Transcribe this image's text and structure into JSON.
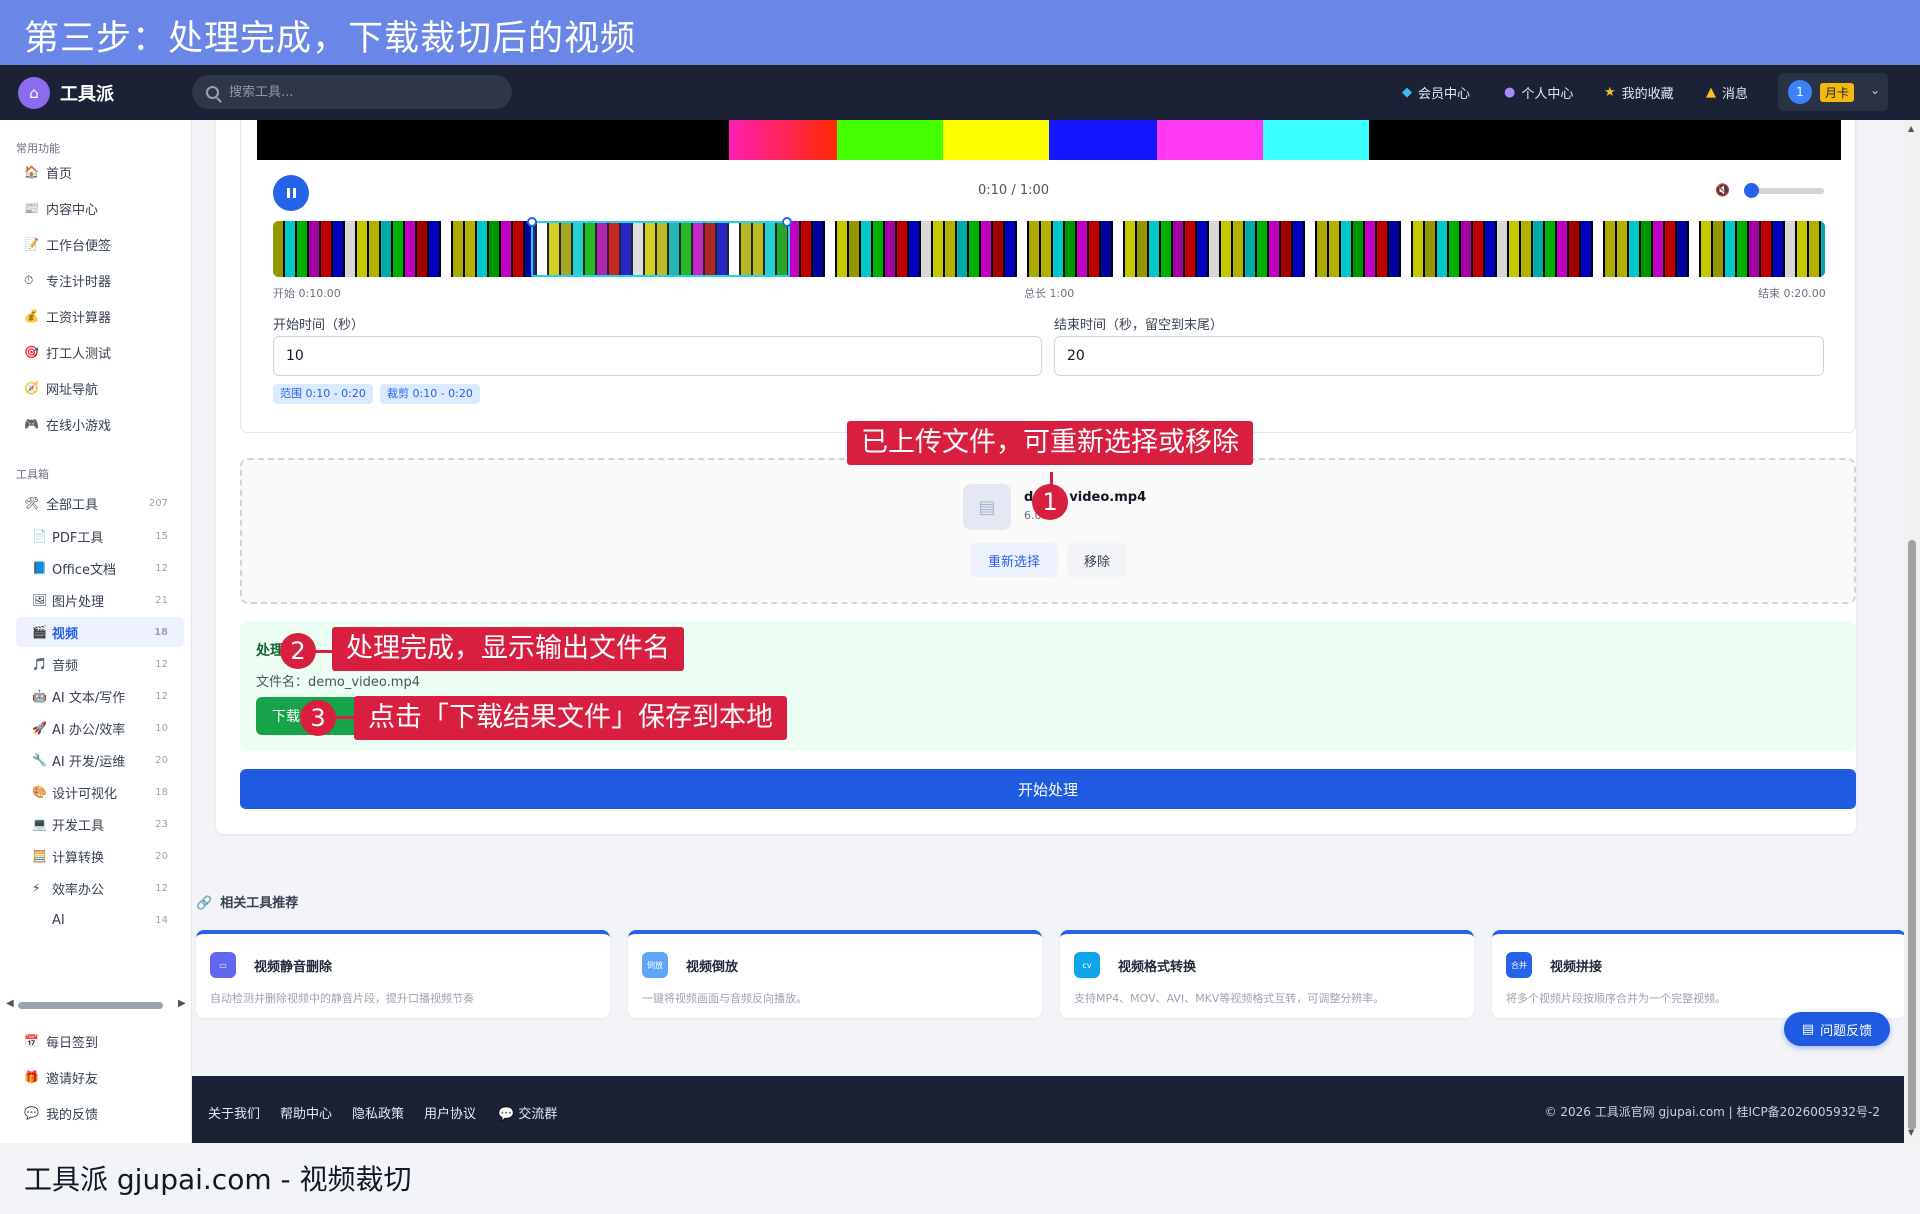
{
  "banner": {
    "title": "第三步：处理完成，下载裁切后的视频"
  },
  "header": {
    "brand": "工具派",
    "search_placeholder": "搜索工具...",
    "nav": [
      {
        "label": "会员中心",
        "icon": "diamond-icon"
      },
      {
        "label": "个人中心",
        "icon": "user-icon"
      },
      {
        "label": "我的收藏",
        "icon": "star-icon"
      },
      {
        "label": "消息",
        "icon": "bell-icon"
      }
    ],
    "user_number": "1",
    "user_badge": "月卡"
  },
  "sidebar": {
    "common_title": "常用功能",
    "common": [
      {
        "label": "首页",
        "icon": "🏠"
      },
      {
        "label": "内容中心",
        "icon": "📰"
      },
      {
        "label": "工作台便签",
        "icon": "📝"
      },
      {
        "label": "专注计时器",
        "icon": "⏱"
      },
      {
        "label": "工资计算器",
        "icon": "💰"
      },
      {
        "label": "打工人测试",
        "icon": "🎯"
      },
      {
        "label": "网址导航",
        "icon": "🧭"
      },
      {
        "label": "在线小游戏",
        "icon": "🎮"
      }
    ],
    "toolbox_title": "工具箱",
    "all_tools": {
      "label": "全部工具",
      "count": "207",
      "icon": "🛠"
    },
    "categories": [
      {
        "label": "PDF工具",
        "count": "15",
        "icon": "📄"
      },
      {
        "label": "Office文档",
        "count": "12",
        "icon": "📘"
      },
      {
        "label": "图片处理",
        "count": "21",
        "icon": "🖼"
      },
      {
        "label": "视频",
        "count": "18",
        "icon": "🎬",
        "active": true
      },
      {
        "label": "音频",
        "count": "12",
        "icon": "🎵"
      },
      {
        "label": "AI 文本/写作",
        "count": "12",
        "icon": "🤖"
      },
      {
        "label": "AI 办公/效率",
        "count": "10",
        "icon": "🚀"
      },
      {
        "label": "AI 开发/运维",
        "count": "20",
        "icon": "🔧"
      },
      {
        "label": "设计可视化",
        "count": "18",
        "icon": "🎨"
      },
      {
        "label": "开发工具",
        "count": "23",
        "icon": "💻"
      },
      {
        "label": "计算转换",
        "count": "20",
        "icon": "🧮"
      },
      {
        "label": "效率办公",
        "count": "12",
        "icon": "⚡"
      },
      {
        "label": "AI",
        "count": "14",
        "icon": ""
      }
    ],
    "bottom": [
      {
        "label": "每日签到",
        "icon": "📅"
      },
      {
        "label": "邀请好友",
        "icon": "🎁"
      },
      {
        "label": "我的反馈",
        "icon": "💬"
      }
    ]
  },
  "player": {
    "time": "0:10 / 1:00",
    "volume": 0,
    "start_label": "开始 0:10.00",
    "total_label": "总长 1:00",
    "end_label": "结束 0:20.00",
    "start_field_label": "开始时间（秒）",
    "start_value": "10",
    "end_field_label": "结束时间（秒，留空到末尾）",
    "end_value": "20",
    "chip_range": "范围 0:10 - 0:20",
    "chip_cut": "裁剪 0:10 - 0:20"
  },
  "upload": {
    "file_name_start": "d",
    "file_name_end": "video.mp4",
    "file_size": "6.0",
    "reselect_label": "重新选择",
    "remove_label": "移除"
  },
  "result": {
    "title": "处理",
    "file_line": "文件名：demo_video.mp4",
    "download_label": "下载"
  },
  "start_button": "开始处理",
  "related": {
    "title": "相关工具推荐",
    "tools": [
      {
        "name": "视频静音删除",
        "desc": "自动检测并删除视频中的静音片段，提升口播视频节奏",
        "icon_text": "▭",
        "color": "#6366f1"
      },
      {
        "name": "视频倒放",
        "desc": "一键将视频画面与音频反向播放。",
        "icon_text": "倒放",
        "color": "#60a5fa"
      },
      {
        "name": "视频格式转换",
        "desc": "支持MP4、MOV、AVI、MKV等视频格式互转，可调整分辨率。",
        "icon_text": "cv",
        "color": "#0ea5e9"
      },
      {
        "name": "视频拼接",
        "desc": "将多个视频片段按顺序合并为一个完整视频。",
        "icon_text": "合并",
        "color": "#2563eb"
      }
    ]
  },
  "feedback_button": "问题反馈",
  "footer": {
    "links": [
      "关于我们",
      "帮助中心",
      "隐私政策",
      "用户协议",
      "交流群"
    ],
    "copyright": "© 2026 工具派官网 gjupai.com | 桂ICP备2026005932号-2"
  },
  "callouts": [
    {
      "num": "1",
      "text": "已上传文件，可重新选择或移除"
    },
    {
      "num": "2",
      "text": "处理完成，显示输出文件名"
    },
    {
      "num": "3",
      "text": "点击「下载结果文件」保存到本地"
    }
  ],
  "caption": "工具派 gjupai.com - 视频裁切"
}
